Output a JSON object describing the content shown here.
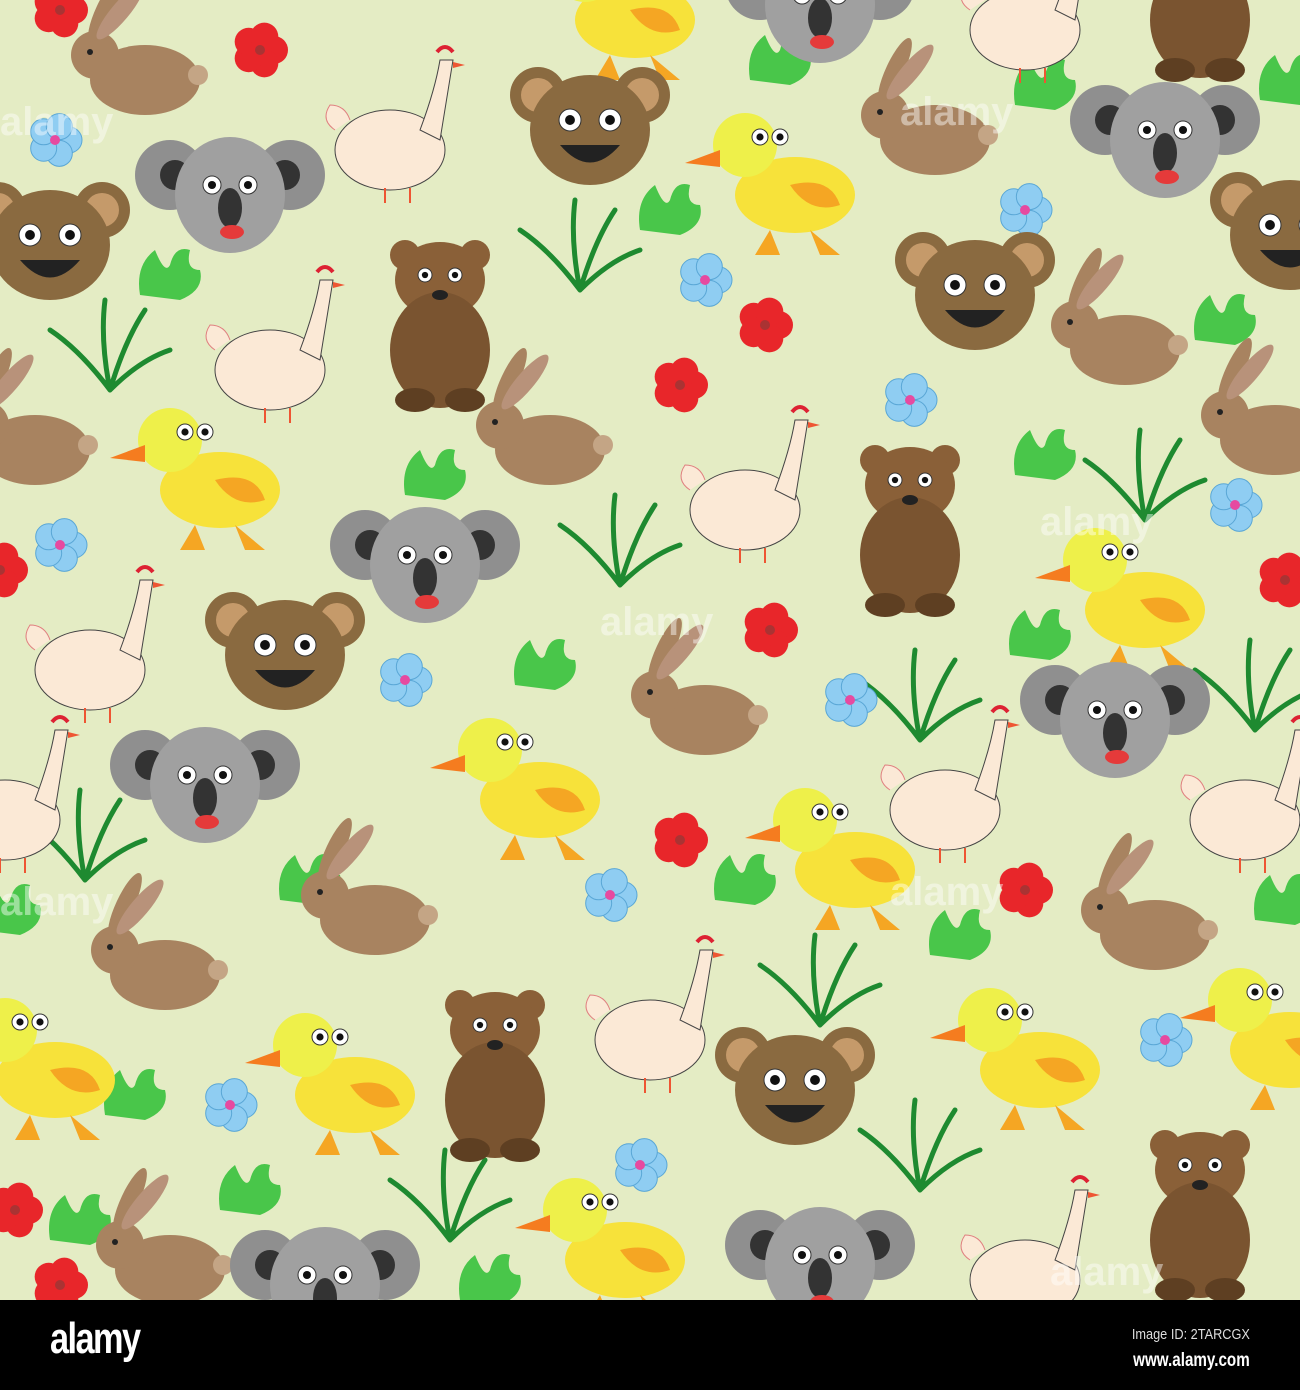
{
  "watermark": "alamy",
  "footer": {
    "logo": "alamy",
    "image_id": "Image ID: 2TARCGX",
    "url": "www.alamy.com"
  },
  "colors": {
    "background": "#e4ecc4",
    "footer": "#000000"
  }
}
